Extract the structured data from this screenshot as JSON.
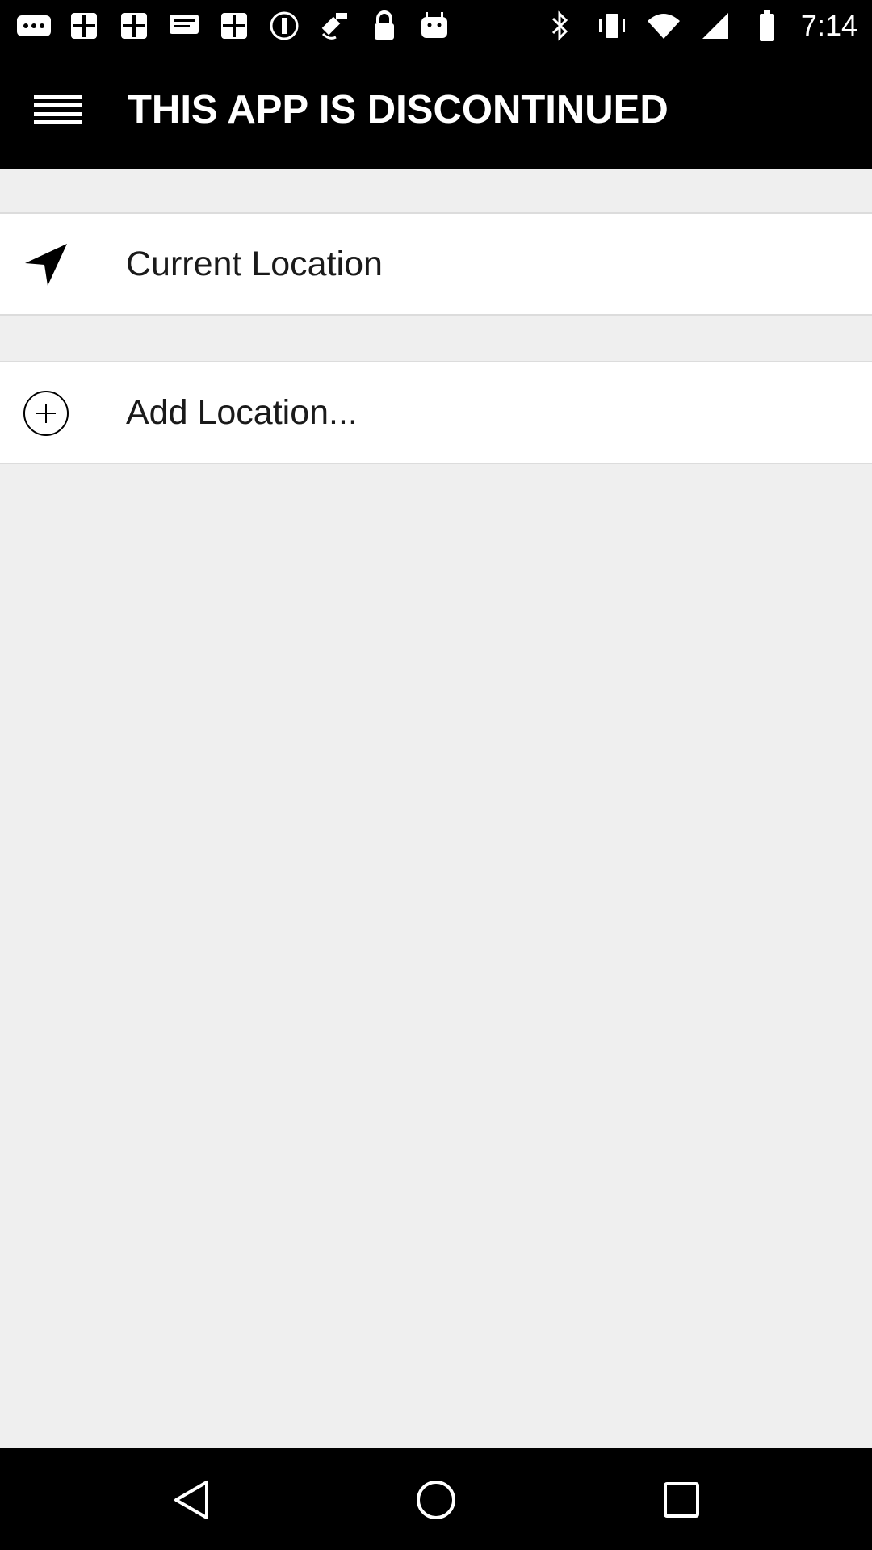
{
  "status_bar": {
    "time": "7:14",
    "left_icons": [
      "more-icon",
      "notification-icon",
      "notification-icon",
      "message-icon",
      "notification-icon",
      "notification-icon",
      "fake-gps-icon",
      "lock-icon",
      "android-icon"
    ],
    "right_icons": [
      "bluetooth-icon",
      "vibrate-icon",
      "wifi-icon",
      "signal-icon",
      "battery-icon"
    ]
  },
  "app_bar": {
    "title": "THIS APP IS DISCONTINUED",
    "menu_icon": "menu-icon"
  },
  "locations": {
    "current": {
      "label": "Current Location",
      "icon": "navigation-arrow-icon"
    },
    "add": {
      "label": "Add Location...",
      "icon": "add-circle-icon"
    }
  },
  "nav_bar": {
    "buttons": [
      "back-icon",
      "home-icon",
      "recent-apps-icon"
    ]
  },
  "colors": {
    "bars": "#000000",
    "background": "#efefef",
    "row": "#ffffff",
    "divider": "#dcdcdc"
  }
}
